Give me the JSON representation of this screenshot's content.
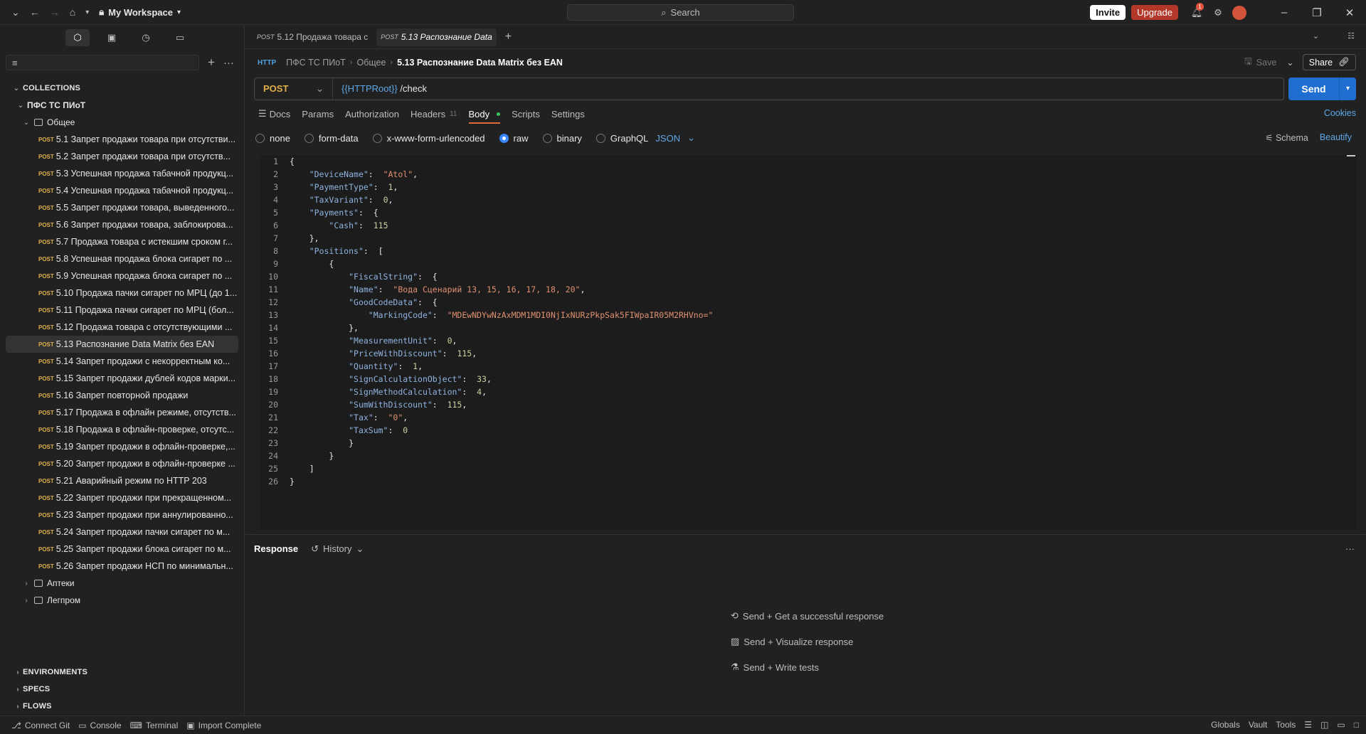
{
  "topbar": {
    "workspace": "My Workspace",
    "search_placeholder": "Search",
    "invite_label": "Invite",
    "upgrade_label": "Upgrade",
    "notif_count": "1"
  },
  "sidebar": {
    "sections": {
      "collections": "COLLECTIONS",
      "environments": "ENVIRONMENTS",
      "specs": "SPECS",
      "flows": "FLOWS"
    },
    "collection_name": "ПФС ТС ПИоТ",
    "folder_general": "Общее",
    "folder_pharmacy": "Аптеки",
    "folder_legprom": "Легпром",
    "method_tag": "POST",
    "requests": [
      "5.1 Запрет продажи товара при отсутстви...",
      "5.2 Запрет продажи товара при отсутств...",
      "5.3 Успешная продажа табачной продукц...",
      "5.4 Успешная продажа табачной продукц...",
      "5.5 Запрет продажи товара, выведенного...",
      "5.6 Запрет продажи товара, заблокирова...",
      "5.7 Продажа товара с истекшим сроком г...",
      "5.8 Успешная продажа блока сигарет по ...",
      "5.9 Успешная продажа блока сигарет по ...",
      "5.10 Продажа пачки сигарет по МРЦ (до 1...",
      "5.11 Продажа пачки сигарет по МРЦ (бол...",
      "5.12 Продажа товара с отсутствующими ...",
      "5.13 Распознание Data Matrix без EAN",
      "5.14 Запрет продажи с некорректным ко...",
      "5.15 Запрет продажи дублей кодов марки...",
      "5.16 Запрет повторной продажи",
      "5.17 Продажа в офлайн режиме, отсутств...",
      "5.18 Продажа в офлайн-проверке, отсутс...",
      "5.19 Запрет продажи в офлайн-проверке,...",
      "5.20 Запрет продажи в офлайн-проверке ...",
      "5.21 Аварийный режим по HTTP 203",
      "5.22 Запрет продажи при прекращенном...",
      "5.23 Запрет продажи при аннулированно...",
      "5.24 Запрет продажи пачки сигарет по м...",
      "5.25 Запрет продажи блока сигарет по м...",
      "5.26 Запрет продажи НСП по минимальн..."
    ]
  },
  "tabs": [
    {
      "method": "POST",
      "label": "5.12 Продажа товара с"
    },
    {
      "method": "POST",
      "label": "5.13 Распознание Data"
    }
  ],
  "breadcrumb": {
    "collection": "ПФС ТС ПИоТ",
    "folder": "Общее",
    "current": "5.13 Распознание Data Matrix без EAN",
    "save_label": "Save",
    "share_label": "Share",
    "http_tag": "HTTP"
  },
  "request": {
    "method": "POST",
    "url_var": "{{HTTPRoot}}",
    "url_path": " /check",
    "send_label": "Send"
  },
  "req_tabs": {
    "docs": "Docs",
    "params": "Params",
    "authorization": "Authorization",
    "headers": "Headers",
    "headers_count": "11",
    "body": "Body",
    "scripts": "Scripts",
    "settings": "Settings",
    "cookies": "Cookies"
  },
  "body_options": {
    "none": "none",
    "form_data": "form-data",
    "urlencoded": "x-www-form-urlencoded",
    "raw": "raw",
    "binary": "binary",
    "graphql": "GraphQL",
    "format": "JSON",
    "schema": "Schema",
    "beautify": "Beautify"
  },
  "code_lines": [
    [
      [
        "p",
        "{"
      ]
    ],
    [
      [
        "p",
        "    "
      ],
      [
        "k",
        "\"DeviceName\""
      ],
      [
        "p",
        ":  "
      ],
      [
        "s",
        "\"Atol\""
      ],
      [
        "p",
        ","
      ]
    ],
    [
      [
        "p",
        "    "
      ],
      [
        "k",
        "\"PaymentType\""
      ],
      [
        "p",
        ":  "
      ],
      [
        "n",
        "1"
      ],
      [
        "p",
        ","
      ]
    ],
    [
      [
        "p",
        "    "
      ],
      [
        "k",
        "\"TaxVariant\""
      ],
      [
        "p",
        ":  "
      ],
      [
        "n",
        "0"
      ],
      [
        "p",
        ","
      ]
    ],
    [
      [
        "p",
        "    "
      ],
      [
        "k",
        "\"Payments\""
      ],
      [
        "p",
        ":  {"
      ]
    ],
    [
      [
        "p",
        "        "
      ],
      [
        "k",
        "\"Cash\""
      ],
      [
        "p",
        ":  "
      ],
      [
        "n",
        "115"
      ]
    ],
    [
      [
        "p",
        "    },"
      ]
    ],
    [
      [
        "p",
        "    "
      ],
      [
        "k",
        "\"Positions\""
      ],
      [
        "p",
        ":  ["
      ]
    ],
    [
      [
        "p",
        "        {"
      ]
    ],
    [
      [
        "p",
        "            "
      ],
      [
        "k",
        "\"FiscalString\""
      ],
      [
        "p",
        ":  {"
      ]
    ],
    [
      [
        "p",
        "            "
      ],
      [
        "k",
        "\"Name\""
      ],
      [
        "p",
        ":  "
      ],
      [
        "s",
        "\"Вода Сценарий 13, 15, 16, 17, 18, 20\""
      ],
      [
        "p",
        ","
      ]
    ],
    [
      [
        "p",
        "            "
      ],
      [
        "k",
        "\"GoodCodeData\""
      ],
      [
        "p",
        ":  {"
      ]
    ],
    [
      [
        "p",
        "                "
      ],
      [
        "k",
        "\"MarkingCode\""
      ],
      [
        "p",
        ":  "
      ],
      [
        "s",
        "\"MDEwNDYwNzAxMDM1MDI0NjIxNURzPkpSak5FIWpaIR05M2RHVno=\""
      ]
    ],
    [
      [
        "p",
        "            },"
      ]
    ],
    [
      [
        "p",
        "            "
      ],
      [
        "k",
        "\"MeasurementUnit\""
      ],
      [
        "p",
        ":  "
      ],
      [
        "n",
        "0"
      ],
      [
        "p",
        ","
      ]
    ],
    [
      [
        "p",
        "            "
      ],
      [
        "k",
        "\"PriceWithDiscount\""
      ],
      [
        "p",
        ":  "
      ],
      [
        "n",
        "115"
      ],
      [
        "p",
        ","
      ]
    ],
    [
      [
        "p",
        "            "
      ],
      [
        "k",
        "\"Quantity\""
      ],
      [
        "p",
        ":  "
      ],
      [
        "n",
        "1"
      ],
      [
        "p",
        ","
      ]
    ],
    [
      [
        "p",
        "            "
      ],
      [
        "k",
        "\"SignCalculationObject\""
      ],
      [
        "p",
        ":  "
      ],
      [
        "n",
        "33"
      ],
      [
        "p",
        ","
      ]
    ],
    [
      [
        "p",
        "            "
      ],
      [
        "k",
        "\"SignMethodCalculation\""
      ],
      [
        "p",
        ":  "
      ],
      [
        "n",
        "4"
      ],
      [
        "p",
        ","
      ]
    ],
    [
      [
        "p",
        "            "
      ],
      [
        "k",
        "\"SumWithDiscount\""
      ],
      [
        "p",
        ":  "
      ],
      [
        "n",
        "115"
      ],
      [
        "p",
        ","
      ]
    ],
    [
      [
        "p",
        "            "
      ],
      [
        "k",
        "\"Tax\""
      ],
      [
        "p",
        ":  "
      ],
      [
        "s",
        "\"0\""
      ],
      [
        "p",
        ","
      ]
    ],
    [
      [
        "p",
        "            "
      ],
      [
        "k",
        "\"TaxSum\""
      ],
      [
        "p",
        ":  "
      ],
      [
        "n",
        "0"
      ]
    ],
    [
      [
        "p",
        "            }"
      ]
    ],
    [
      [
        "p",
        "        }"
      ]
    ],
    [
      [
        "p",
        "    ]"
      ]
    ],
    [
      [
        "p",
        "}"
      ]
    ]
  ],
  "response": {
    "title": "Response",
    "history": "History",
    "hints": [
      "Send + Get a successful response",
      "Send + Visualize response",
      "Send + Write tests"
    ]
  },
  "statusbar": {
    "connect_git": "Connect Git",
    "console": "Console",
    "terminal": "Terminal",
    "import_complete": "Import Complete",
    "globals": "Globals",
    "vault": "Vault",
    "tools": "Tools"
  },
  "icons": {
    "chevron_down": "chevron-down-icon",
    "back": "back-arrow-icon",
    "forward": "forward-arrow-icon",
    "home": "home-icon",
    "lock": "lock-icon",
    "search": "search-icon",
    "bell": "bell-icon",
    "gear": "gear-icon"
  }
}
